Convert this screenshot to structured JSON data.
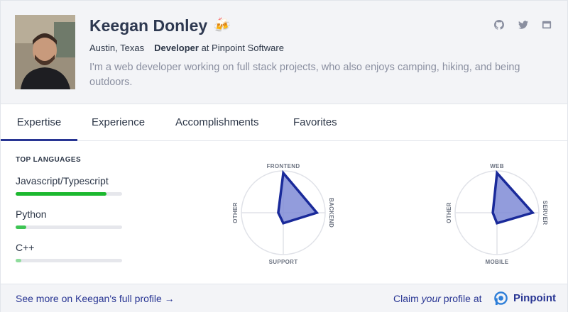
{
  "profile": {
    "name": "Keegan Donley",
    "emoji": "🍻",
    "location": "Austin, Texas",
    "role": "Developer",
    "company_prefix": " at ",
    "company": "Pinpoint Software",
    "bio": "I'm a web developer working on full stack projects, who also enjoys camping, hiking, and being outdoors."
  },
  "social": [
    "github-icon",
    "twitter-icon",
    "website-icon"
  ],
  "tabs": [
    {
      "label": "Expertise",
      "active": true
    },
    {
      "label": "Experience",
      "active": false
    },
    {
      "label": "Accomplishments",
      "active": false
    },
    {
      "label": "Favorites",
      "active": false
    }
  ],
  "languages": {
    "title": "TOP LANGUAGES",
    "items": [
      {
        "name": "Javascript/Typescript",
        "level": 0.85,
        "color": "#1cb82f"
      },
      {
        "name": "Python",
        "level": 0.1,
        "color": "#3ec454"
      },
      {
        "name": "C++",
        "level": 0.05,
        "color": "#8fdc9c"
      }
    ]
  },
  "radars": [
    {
      "axes": {
        "top": "FRONTEND",
        "right": "BACKEND",
        "bottom": "SUPPORT",
        "left": "OTHER"
      },
      "values": {
        "top": 0.95,
        "right": 0.8,
        "bottom": 0.25,
        "left": 0.12
      }
    },
    {
      "axes": {
        "top": "WEB",
        "right": "SERVER",
        "bottom": "MOBILE",
        "left": "OTHER"
      },
      "values": {
        "top": 0.95,
        "right": 0.85,
        "bottom": 0.25,
        "left": 0.1
      }
    }
  ],
  "footer": {
    "link": "See more on Keegan's full profile →",
    "claim_prefix": "Claim ",
    "claim_em": "your",
    "claim_suffix": " profile at",
    "brand": "Pinpoint"
  },
  "colors": {
    "accent": "#283593",
    "radar_fill": "#7f8bd6",
    "radar_stroke": "#1a2a9a"
  }
}
